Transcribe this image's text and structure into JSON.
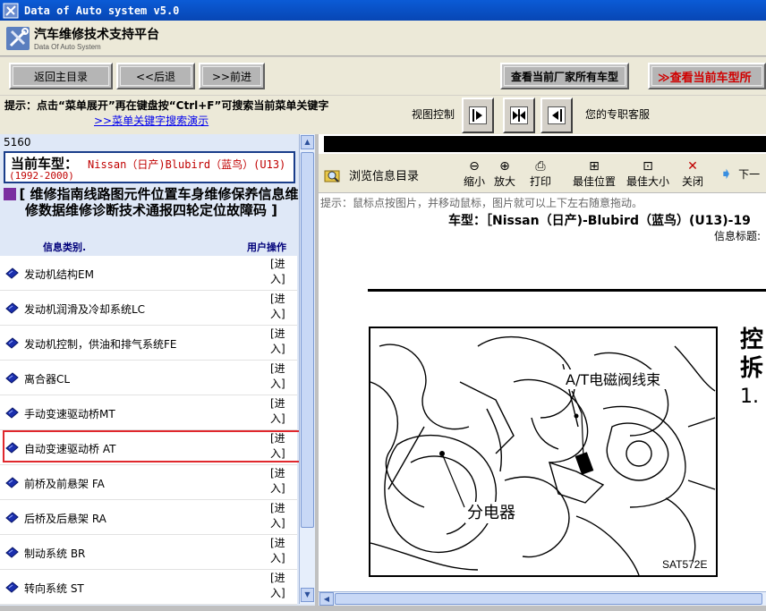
{
  "window": {
    "title": "Data of Auto system v5.0"
  },
  "header": {
    "title": "汽车维修技术支持平台",
    "subtitle": "Data Of Auto System"
  },
  "nav": {
    "home": "返回主目录",
    "back": "<<后退",
    "forward": ">>前进",
    "all_models": "查看当前厂家所有车型",
    "current_model": "≫查看当前车型所"
  },
  "tips": {
    "text": "提示：点击“菜单展开”再在键盘按“Ctrl+F”可搜索当前菜单关键字",
    "link": ">>菜单关键字搜索演示",
    "view_control": "视图控制",
    "service": "您的专职客服"
  },
  "left": {
    "counter": "5160",
    "car_label": "当前车型：",
    "car_name": "Nissan（日产)Blubird（蓝鸟）(U13)",
    "car_years": "(1992-2000)",
    "heading": "[ 维修指南线路图元件位置车身维修保养信息维修数据维修诊断技术通报四轮定位故障码 ]",
    "col_category": "信息类别.",
    "col_action": "用户操作",
    "action_label": "[进入]",
    "items": [
      {
        "label": "发动机结构EM"
      },
      {
        "label": "发动机润滑及冷却系统LC"
      },
      {
        "label": "发动机控制，供油和排气系统FE"
      },
      {
        "label": "离合器CL"
      },
      {
        "label": "手动变速驱动桥MT"
      },
      {
        "label": "自动变速驱动桥 AT"
      },
      {
        "label": "前桥及前悬架 FA"
      },
      {
        "label": "后桥及后悬架 RA"
      },
      {
        "label": "制动系统 BR"
      },
      {
        "label": "转向系统 ST"
      }
    ]
  },
  "viewer": {
    "toolbar": {
      "browse": "浏览信息目录",
      "zoom_out": "缩小",
      "zoom_in": "放大",
      "print": "打印",
      "best_position": "最佳位置",
      "best_size": "最佳大小",
      "close": "关闭",
      "next": "下一"
    },
    "hint": "提示：鼠标点按图片，并移动鼠标，图片就可以上下左右随意拖动。",
    "model": "车型：［Nissan（日产)-Blubird（蓝鸟）(U13)-19",
    "info_title": "信息标题:",
    "diagram": {
      "label_solenoid": "A/T电磁阀线束",
      "label_distributor": "分电器",
      "code": "SAT572E"
    },
    "side_text": [
      "控",
      "拆",
      "1."
    ]
  },
  "colors": {
    "title_bar": "#0b5bd6",
    "highlight": "#e0282d",
    "car_text": "#c00000",
    "link": "#0000ee"
  }
}
